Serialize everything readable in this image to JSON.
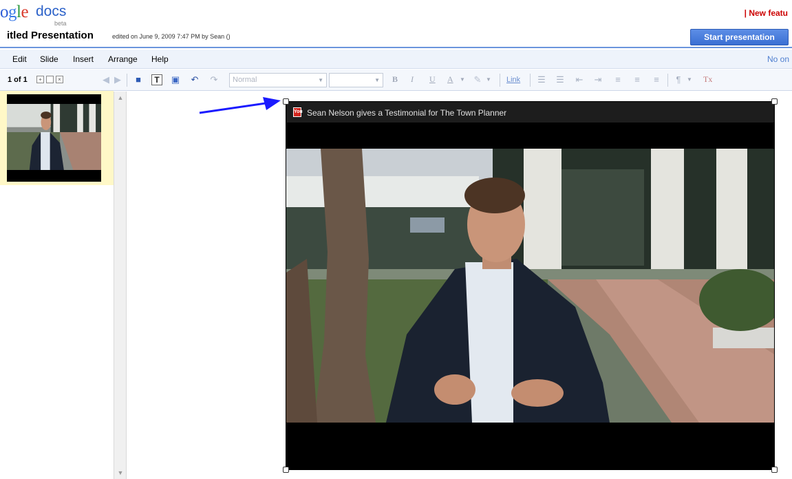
{
  "header": {
    "logo_text": "ogle",
    "logo_docs": "docs",
    "logo_beta": "beta",
    "new_features_link": "| New featu",
    "doc_title": "itled Presentation",
    "edited_info": "edited on June 9, 2009 7:47 PM by Sean ()",
    "start_presentation_button": "Start presentation"
  },
  "menubar": {
    "items": [
      "Edit",
      "Slide",
      "Insert",
      "Arrange",
      "Help"
    ],
    "right_label": "No on"
  },
  "toolbar": {
    "slide_count": "1 of 1",
    "font_style_select": "Normal",
    "font_size_select": "",
    "bold_label": "B",
    "italic_label": "I",
    "underline_label": "U",
    "text_color_label": "A",
    "link_label": "Link",
    "clear_format_label": "Tx"
  },
  "video": {
    "title": "Sean Nelson gives a Testimonial for The Town Planner",
    "icon_label": "You"
  },
  "colors": {
    "accent_blue": "#2c62c9",
    "start_button": "#3a6fd3",
    "new_features_red": "#cc0000",
    "selected_thumb_bg": "#fff8c7",
    "annotation_arrow": "#1a1aff"
  }
}
